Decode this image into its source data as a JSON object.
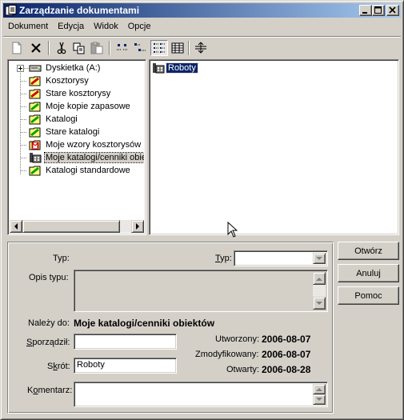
{
  "window": {
    "title": "Zarządzanie dokumentami"
  },
  "menu": [
    "Dokument",
    "Edycja",
    "Widok",
    "Opcje"
  ],
  "tree": {
    "items": [
      {
        "label": "Dyskietka (A:)",
        "icon": "floppy-drive-icon"
      },
      {
        "label": "Kosztorysy",
        "icon": "folder-red-icon"
      },
      {
        "label": "Stare kosztorysy",
        "icon": "folder-red-icon"
      },
      {
        "label": "Moje kopie zapasowe",
        "icon": "folder-green-icon"
      },
      {
        "label": "Katalogi",
        "icon": "folder-green-icon"
      },
      {
        "label": "Stare katalogi",
        "icon": "folder-green-icon"
      },
      {
        "label": "Moje wzory kosztorysów",
        "icon": "folder-template-icon"
      },
      {
        "label": "Moje katalogi/cenniki obie",
        "icon": "building-icon"
      },
      {
        "label": "Katalogi standardowe",
        "icon": "folder-green-icon"
      }
    ]
  },
  "list": {
    "items": [
      {
        "label": "Roboty",
        "icon": "building-icon"
      }
    ]
  },
  "details": {
    "typ_label": "Typ:",
    "typ_combo_label_u": "T",
    "typ_combo_label_rest": "yp:",
    "typ_value": "",
    "opis_label": "Opis typu:",
    "nalezy_label": "Należy do:",
    "nalezy_value": "Moje katalogi/cenniki obiektów",
    "sporzadzil_u": "S",
    "sporzadzil_rest": "porządził:",
    "sporzadzil_value": "",
    "skrot_pre": "S",
    "skrot_u": "k",
    "skrot_rest": "rót:",
    "skrot_value": "Roboty",
    "komentarz_pre": "K",
    "komentarz_u": "o",
    "komentarz_rest": "mentarz:",
    "komentarz_value": "",
    "utworzony_label": "Utworzony:",
    "utworzony_value": "2006-08-07",
    "zmodyfikowany_label": "Zmodyfikowany:",
    "zmodyfikowany_value": "2006-08-07",
    "otwarty_label": "Otwarty:",
    "otwarty_value": "2006-08-28"
  },
  "buttons": {
    "open": "Otwórz",
    "cancel": "Anuluj",
    "help": "Pomoc"
  }
}
